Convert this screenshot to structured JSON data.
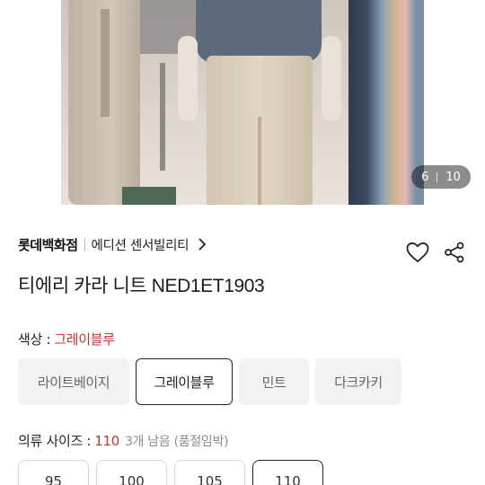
{
  "gallery": {
    "current_page": "6",
    "total_pages": "10"
  },
  "brand": {
    "store": "롯데백화점",
    "shop": "에디션 센서빌리티"
  },
  "product": {
    "title": "티에리 카라 니트 NED1ET1903"
  },
  "color_option": {
    "label": "색상 :",
    "selected": "그레이블루",
    "options": [
      {
        "label": "라이트베이지"
      },
      {
        "label": "그레이블루"
      },
      {
        "label": "민트"
      },
      {
        "label": "다크카키"
      }
    ]
  },
  "size_option": {
    "label": "의류 사이즈 :",
    "selected": "110",
    "stock_note": "3개 남음 (품절임박)",
    "options": [
      {
        "label": "95"
      },
      {
        "label": "100"
      },
      {
        "label": "105"
      },
      {
        "label": "110"
      }
    ]
  },
  "icons": {
    "wishlist": "heart-icon",
    "share": "share-icon",
    "brand_link": "chevron-right-icon"
  },
  "colors": {
    "accent_selected": "#c0392b",
    "chip_bg": "#f2f2f2",
    "active_border": "#222222"
  }
}
